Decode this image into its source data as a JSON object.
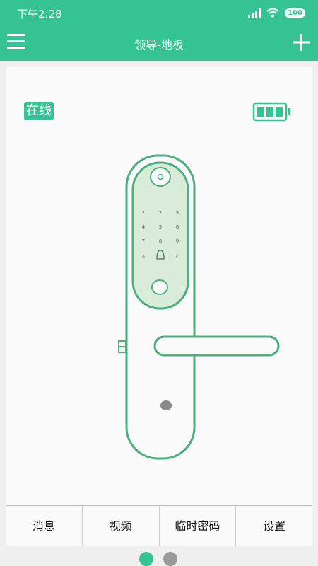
{
  "status_bar": {
    "time": "下午2:28",
    "battery": "100",
    "icons": [
      "signal-icon",
      "wifi-icon",
      "battery-icon"
    ]
  },
  "app_bar": {
    "title": "领导-地板",
    "menu_icon": "menu-icon",
    "add_icon": "plus-icon"
  },
  "device": {
    "status_label": "在线",
    "battery_icon": "device-battery-icon",
    "battery_level": 1.0,
    "keypad": [
      "1",
      "2",
      "3",
      "4",
      "5",
      "6",
      "7",
      "8",
      "9",
      "×",
      "🔔",
      "✓"
    ]
  },
  "tabs": [
    {
      "label": "消息"
    },
    {
      "label": "视频"
    },
    {
      "label": "临时密码"
    },
    {
      "label": "设置"
    }
  ],
  "pager": {
    "pages": 2,
    "current": 1
  },
  "colors": {
    "accent": "#35c394",
    "lock_outline": "#4caf7d",
    "lock_panel": "#d9ecd9"
  }
}
